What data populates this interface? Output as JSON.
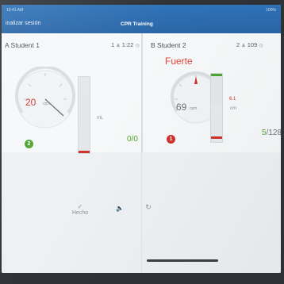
{
  "status_bar": {
    "time": "10:41 AM",
    "right": "100%"
  },
  "header": {
    "finish_label": "inalizar sesión",
    "title": "CPR Training"
  },
  "student_a": {
    "name": "A Student 1",
    "session_number": "1",
    "timer": "1:22",
    "rate_value": "20",
    "rate_unit": "cpm",
    "depth_unit": "mL",
    "score": "0/0",
    "badge": "2"
  },
  "student_b": {
    "name": "B Student 2",
    "session_number": "2",
    "timer": "109",
    "status_word": "Fuerte",
    "rate_value": "69",
    "rate_unit": "cpm",
    "depth_value": "6.1",
    "depth_unit": "cm",
    "score_good": "5",
    "score_total": "/128",
    "badge": "1",
    "depth_fill_fraction": 0.55
  },
  "controls": {
    "done_label": "Hecho",
    "done_icon": "check-icon",
    "mute_icon": "volume-icon",
    "reset_icon": "refresh-icon"
  },
  "colors": {
    "header_blue": "#2c6aad",
    "alert_red": "#d0312d",
    "good_green": "#4ea62f"
  }
}
